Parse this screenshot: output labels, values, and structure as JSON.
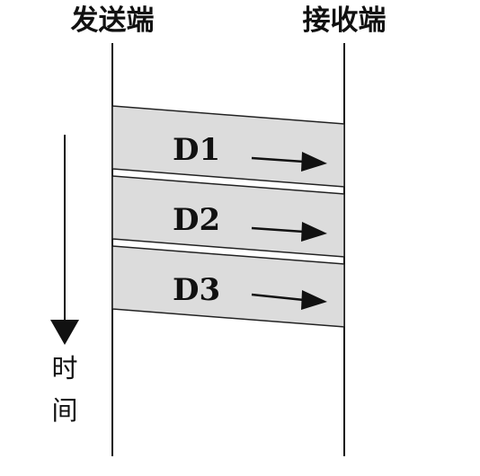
{
  "sender": {
    "label": "发送端"
  },
  "receiver": {
    "label": "接收端"
  },
  "time_axis": {
    "label_line1": "时",
    "label_line2": "间"
  },
  "packets": [
    {
      "label": "D1"
    },
    {
      "label": "D2"
    },
    {
      "label": "D3"
    }
  ],
  "colors": {
    "line": "#111111",
    "packet_fill": "#dcdcdc",
    "packet_stroke": "#222222"
  }
}
